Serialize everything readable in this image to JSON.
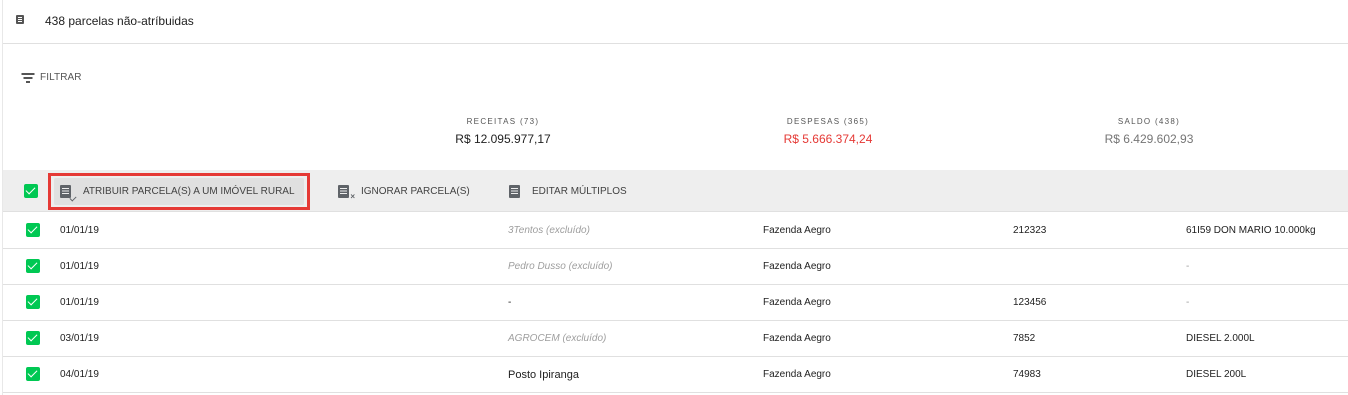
{
  "header": {
    "title": "438 parcelas não-atríbuidas",
    "icon": "document-icon"
  },
  "filter": {
    "label": "FILTRAR",
    "icon": "filter-list-icon"
  },
  "summary": {
    "receitas": {
      "label": "RECEITAS (73)",
      "value": "R$ 12.095.977,17",
      "color": "#212121"
    },
    "despesas": {
      "label": "DESPESAS (365)",
      "value": "R$ 5.666.374,24",
      "color": "#e53935"
    },
    "saldo": {
      "label": "SALDO (438)",
      "value": "R$ 6.429.602,93",
      "color": "#757575"
    }
  },
  "toolbar": {
    "select_all_checked": true,
    "atribuir_label": "ATRIBUIR PARCELA(S) A UM IMÓVEL RURAL",
    "ignorar_label": "IGNORAR PARCELA(S)",
    "editar_label": "EDITAR MÚLTIPLOS",
    "highlight_color": "#e53935"
  },
  "rows": [
    {
      "checked": true,
      "date": "01/01/19",
      "name": "3Tentos (excluído)",
      "farm": "Fazenda Aegro",
      "code": "212323",
      "product": "61I59 DON MARIO 10.000kg"
    },
    {
      "checked": true,
      "date": "01/01/19",
      "name": "Pedro Dusso (excluído)",
      "farm": "Fazenda Aegro",
      "code": "",
      "product": "-"
    },
    {
      "checked": true,
      "date": "01/01/19",
      "name": "-",
      "farm": "Fazenda Aegro",
      "code": "123456",
      "product": "-"
    },
    {
      "checked": true,
      "date": "03/01/19",
      "name": "AGROCEM (excluído)",
      "farm": "Fazenda Aegro",
      "code": "7852",
      "product": "DIESEL 2.000L"
    },
    {
      "checked": true,
      "date": "04/01/19",
      "name": "Posto Ipiranga",
      "farm": "Fazenda Aegro",
      "code": "74983",
      "product": "DIESEL 200L"
    }
  ],
  "colors": {
    "checkbox": "#00c853",
    "accent_red": "#e53935"
  }
}
